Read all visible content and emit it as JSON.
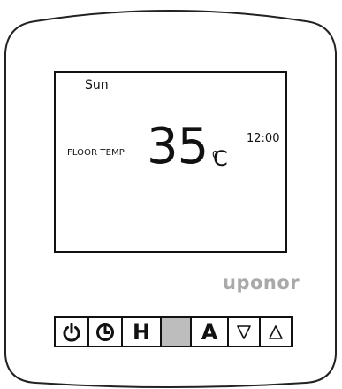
{
  "display": {
    "day": "Sun",
    "label": "FLOOR TEMP",
    "temperature": "35",
    "unit_degree": "0",
    "unit_letter": "C",
    "time": "12:00"
  },
  "brand": {
    "name": "uponor"
  },
  "buttons": [
    {
      "id": "power",
      "icon": "power-icon"
    },
    {
      "id": "clock",
      "icon": "clock-icon"
    },
    {
      "id": "holiday",
      "label": "H"
    },
    {
      "id": "blank",
      "label": ""
    },
    {
      "id": "auto",
      "label": "A"
    },
    {
      "id": "down",
      "icon": "triangle-down-icon"
    },
    {
      "id": "up",
      "icon": "triangle-up-icon"
    }
  ],
  "colors": {
    "outline": "#111111",
    "brand": "#a9a9a9",
    "blank_button": "#bdbdbd"
  }
}
